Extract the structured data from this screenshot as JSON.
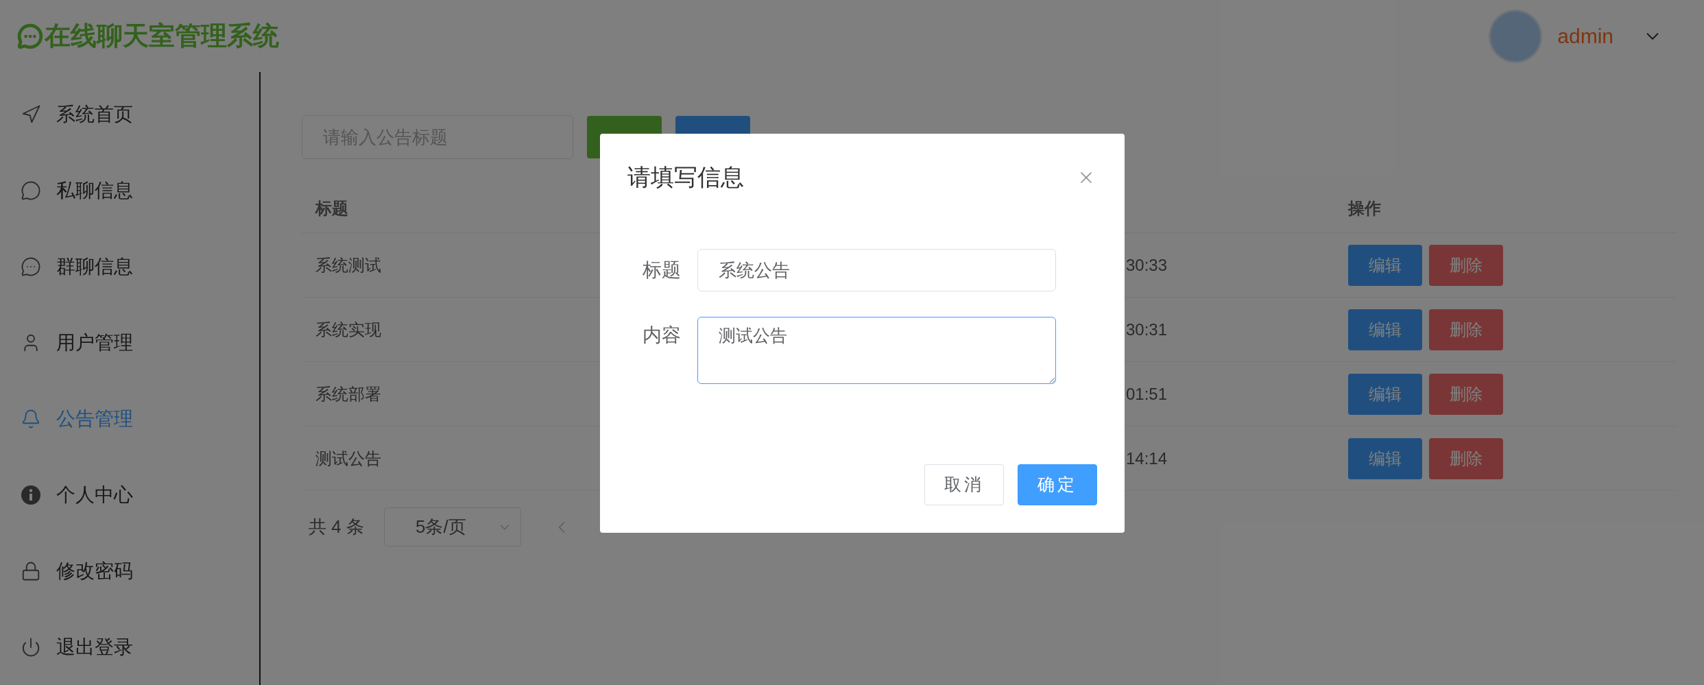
{
  "header": {
    "logo_title": "在线聊天室管理系统",
    "username": "admin"
  },
  "sidebar": {
    "items": [
      {
        "label": "系统首页",
        "kind": "navigation",
        "selected": false
      },
      {
        "label": "私聊信息",
        "kind": "chat",
        "selected": false
      },
      {
        "label": "群聊信息",
        "kind": "group-chat",
        "selected": false
      },
      {
        "label": "用户管理",
        "kind": "user",
        "selected": false
      },
      {
        "label": "公告管理",
        "kind": "bell",
        "selected": true
      },
      {
        "label": "个人中心",
        "kind": "info",
        "selected": false
      },
      {
        "label": "修改密码",
        "kind": "lock",
        "selected": false
      },
      {
        "label": "退出登录",
        "kind": "power",
        "selected": false
      }
    ]
  },
  "toolbar": {
    "search": {
      "placeholder": "请输入公告标题"
    },
    "buttons": [
      {
        "kind": "query"
      },
      {
        "kind": "add"
      }
    ]
  },
  "table": {
    "columns": [
      "标题",
      "操作"
    ],
    "rows": [
      {
        "title": "系统测试",
        "column_2": "30:33",
        "actions": [
          {
            "label": "编辑",
            "kind": "edit"
          },
          {
            "label": "删除",
            "kind": "delete"
          }
        ]
      },
      {
        "title": "系统实现",
        "column_2": "30:31",
        "actions": [
          {
            "label": "编辑",
            "kind": "edit"
          },
          {
            "label": "删除",
            "kind": "delete"
          }
        ]
      },
      {
        "title": "系统部署",
        "column_2": "01:51",
        "actions": [
          {
            "label": "编辑",
            "kind": "edit"
          },
          {
            "label": "删除",
            "kind": "delete"
          }
        ]
      },
      {
        "title": "测试公告",
        "column_2": "14:14",
        "actions": [
          {
            "label": "编辑",
            "kind": "edit"
          },
          {
            "label": "删除",
            "kind": "delete"
          }
        ]
      }
    ]
  },
  "pagination": {
    "total": "共 4 条",
    "page_size": "5条/页"
  },
  "dialog": {
    "title": "请填写信息",
    "fields": [
      {
        "label": "标题",
        "kind": "input",
        "value": "系统公告",
        "focused": false
      },
      {
        "label": "内容",
        "kind": "textarea",
        "value": "测试公告",
        "focused": true
      }
    ],
    "buttons": [
      {
        "label": "取消",
        "kind": "default"
      },
      {
        "label": "确定",
        "kind": "primary"
      }
    ]
  }
}
